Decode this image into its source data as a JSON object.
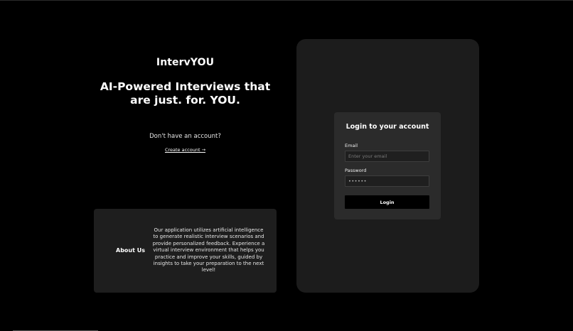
{
  "hero": {
    "brand": "IntervYOU",
    "tagline": "AI-Powered Interviews that are just. for. YOU.",
    "signup_prompt": "Don't have an account?",
    "create_account_link": "Create account →"
  },
  "about": {
    "title": "About Us",
    "text": "Our application utilizes artificial intelligence to generate realistic interview scenarios and provide personalized feedback. Experience a virtual interview environment that helps you practice and improve your skills, guided by insights to take your preparation to the next level!"
  },
  "login": {
    "heading": "Login to your account",
    "email_label": "Email",
    "email_placeholder": "Enter your email",
    "email_value": "",
    "password_label": "Password",
    "password_value": "••••••",
    "button_label": "Login"
  },
  "colors": {
    "background": "#000000",
    "panel": "#1c1c1c",
    "card": "#2b2b2b",
    "button": "#000000"
  }
}
